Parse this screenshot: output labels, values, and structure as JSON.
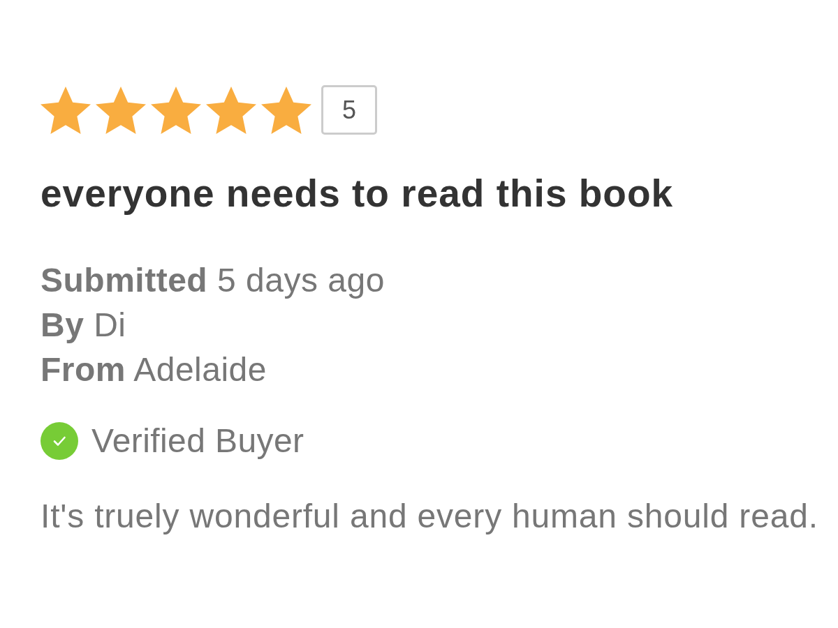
{
  "review": {
    "rating": {
      "stars": 5,
      "score": "5"
    },
    "title": "everyone needs to read this book",
    "meta": [
      {
        "label": "Submitted",
        "value": "5 days ago"
      },
      {
        "label": "By",
        "value": "Di"
      },
      {
        "label": "From",
        "value": "Adelaide"
      }
    ],
    "verified": {
      "on": true,
      "label": "Verified Buyer"
    },
    "body": "It's truely wonderful and every human should read."
  }
}
